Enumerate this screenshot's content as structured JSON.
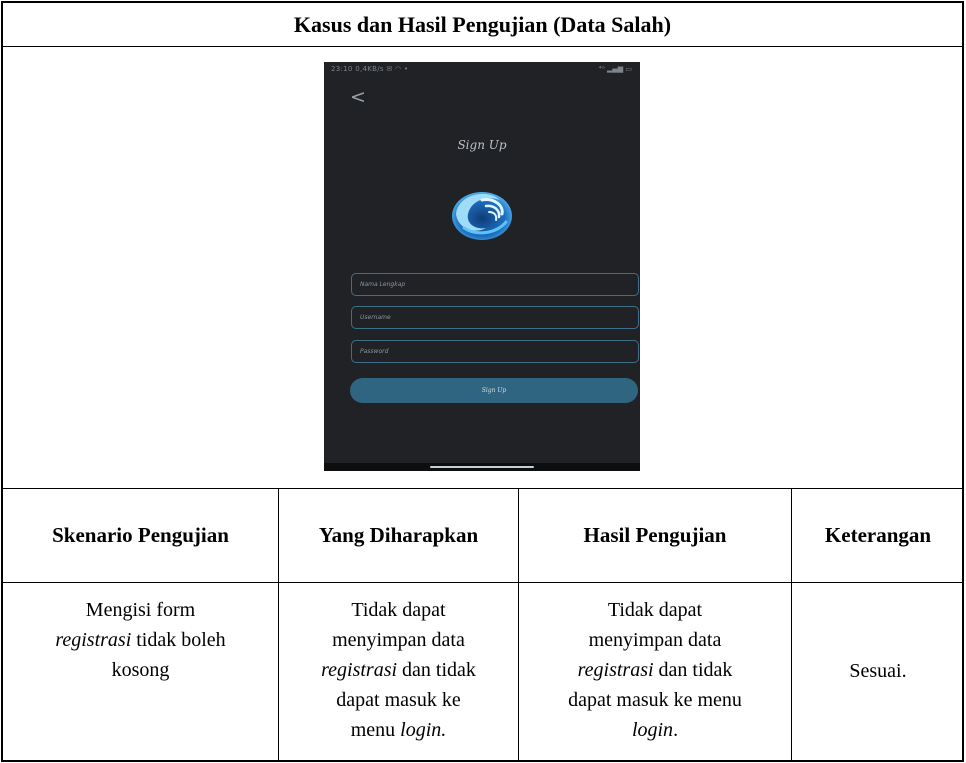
{
  "title": "Kasus dan Hasil Pengujian (Data Salah)",
  "phone": {
    "status_left": "23:10 0,4KB/s ✉ ◠ •",
    "status_right": "⁴ᴳ ▂▄▆ ▭",
    "back_label": "<",
    "screen_title": "Sign Up",
    "logo_icon": "water-wave-logo",
    "field_1_placeholder": "Nama Lengkap",
    "field_2_placeholder": "Username",
    "field_3_placeholder": "Password",
    "button_label": "Sign Up",
    "colors": {
      "background": "#212226",
      "accent": "#2f6581",
      "border": "#3f6e8a"
    }
  },
  "headers": {
    "col1": "Skenario Pengujian",
    "col2": "Yang Diharapkan",
    "col3": "Hasil Pengujian",
    "col4": "Keterangan"
  },
  "row": {
    "col1": {
      "p1": "Mengisi form",
      "p2_i": "registrasi",
      "p2": " tidak boleh",
      "p3": "kosong"
    },
    "col2": {
      "p1": "Tidak dapat",
      "p2": "menyimpan data",
      "p3_i": "registrasi",
      "p3": " dan tidak",
      "p4": "dapat masuk ke",
      "p5": "menu ",
      "p5_i": "login."
    },
    "col3": {
      "p1": "Tidak dapat",
      "p2": "menyimpan data",
      "p3_i": "registrasi",
      "p3": " dan tidak",
      "p4": "dapat masuk ke menu",
      "p5_i": "login",
      "p5": "."
    },
    "col4": "Sesuai."
  }
}
